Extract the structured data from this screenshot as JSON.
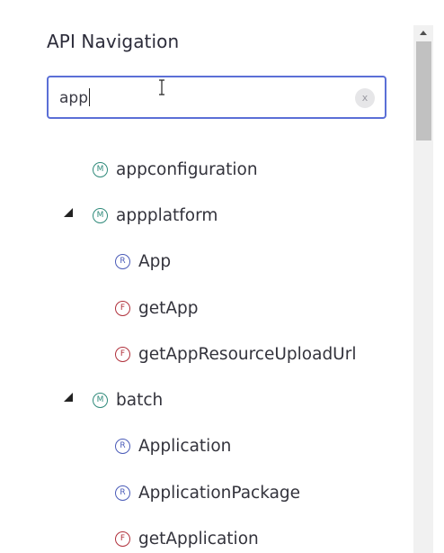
{
  "panel": {
    "title": "API Navigation"
  },
  "search": {
    "value": "app",
    "clear_label": "x"
  },
  "tree": [
    {
      "kind": "M",
      "label": "appconfiguration",
      "expanded": false
    },
    {
      "kind": "M",
      "label": "appplatform",
      "expanded": true
    },
    {
      "kind": "R",
      "label": "App"
    },
    {
      "kind": "F",
      "label": "getApp"
    },
    {
      "kind": "F",
      "label": "getAppResourceUploadUrl"
    },
    {
      "kind": "M",
      "label": "batch",
      "expanded": true
    },
    {
      "kind": "R",
      "label": "Application"
    },
    {
      "kind": "R",
      "label": "ApplicationPackage"
    },
    {
      "kind": "F",
      "label": "getApplication"
    }
  ],
  "colors": {
    "module": "#2f8a7a",
    "resource": "#4a5bb8",
    "function": "#b0303b",
    "search_border": "#5b6fd6"
  }
}
